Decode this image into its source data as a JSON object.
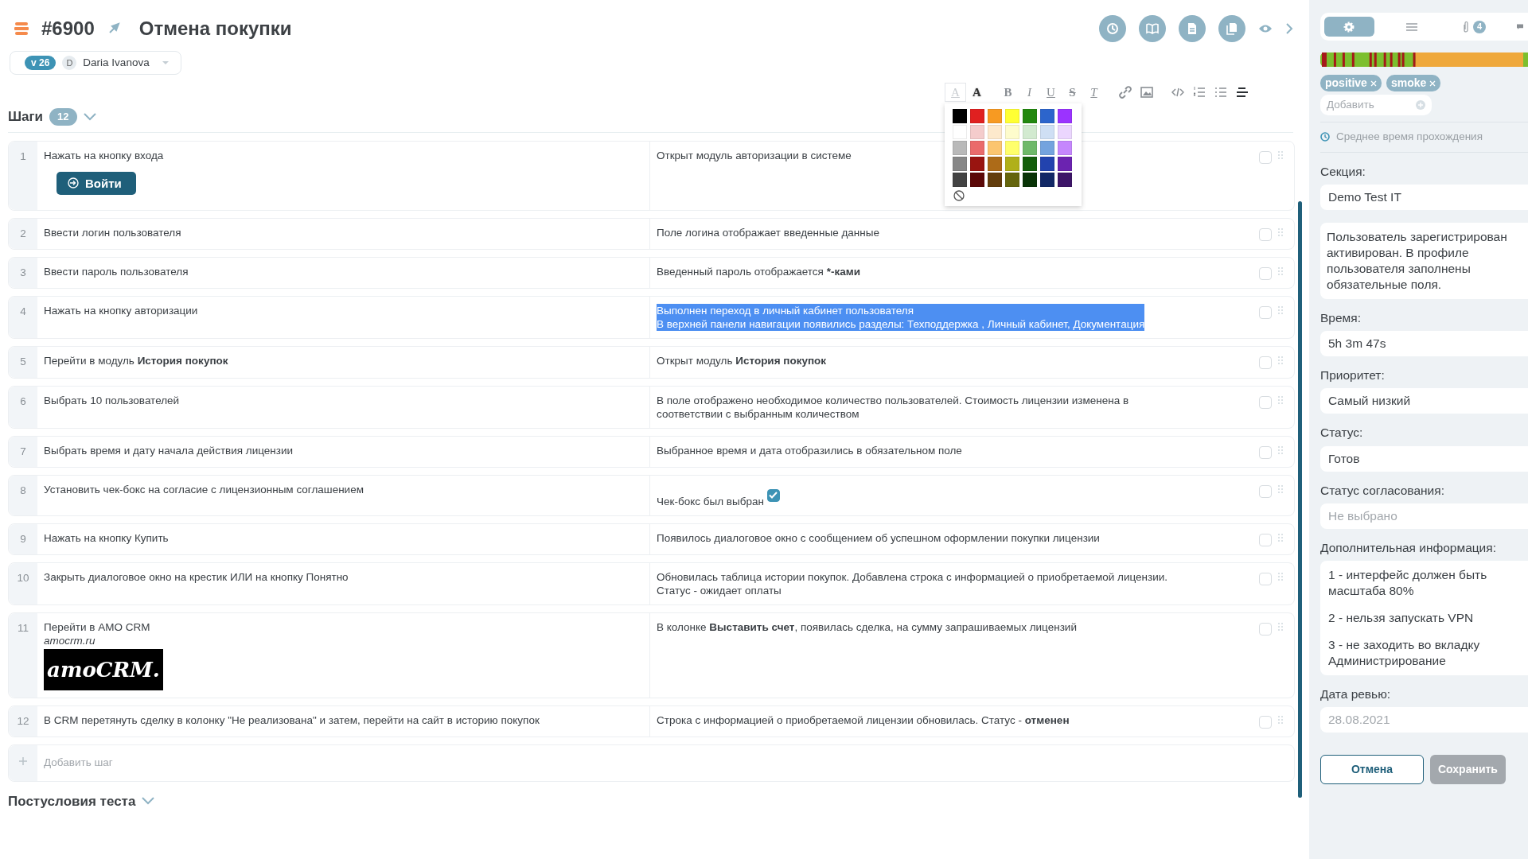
{
  "header": {
    "number": "#6900",
    "title": "Отмена покупки",
    "version": "v 26",
    "author_initial": "D",
    "author": "Daria Ivanova"
  },
  "editor_toolbar": [
    {
      "kind": "text-color",
      "glyph": "A",
      "selected": true
    },
    {
      "kind": "highlight",
      "glyph": "A",
      "selected": false
    },
    {
      "kind": "bold",
      "glyph": "B",
      "selected": false
    },
    {
      "kind": "italic",
      "glyph": "I",
      "selected": false
    },
    {
      "kind": "underline",
      "glyph": "U",
      "selected": false
    },
    {
      "kind": "strike",
      "glyph": "S",
      "selected": false
    },
    {
      "kind": "clear",
      "glyph": "T",
      "selected": false
    },
    {
      "kind": "link",
      "selected": false
    },
    {
      "kind": "image",
      "selected": false
    },
    {
      "kind": "code",
      "selected": false
    },
    {
      "kind": "ordered-list",
      "selected": false
    },
    {
      "kind": "bullet-list",
      "selected": false
    },
    {
      "kind": "align",
      "selected": false
    }
  ],
  "color_palette": [
    [
      {
        "color": "#000000"
      },
      {
        "color": "#e02020"
      },
      {
        "color": "#f79a22"
      },
      {
        "color": "#ffff33"
      },
      {
        "color": "#22880f"
      },
      {
        "color": "#2c65cc"
      },
      {
        "color": "#9b33ff"
      }
    ],
    [
      {
        "color": "#ffffff"
      },
      {
        "color": "#f4cccc"
      },
      {
        "color": "#fde9cc"
      },
      {
        "color": "#fefccc"
      },
      {
        "color": "#d2ead0"
      },
      {
        "color": "#cfdff4"
      },
      {
        "color": "#ebd6fe"
      }
    ],
    [
      {
        "color": "#b9b9b9"
      },
      {
        "color": "#ea6b6b"
      },
      {
        "color": "#fbc56f"
      },
      {
        "color": "#ffff6b"
      },
      {
        "color": "#6fb96a"
      },
      {
        "color": "#74a3de"
      },
      {
        "color": "#c587fd"
      }
    ],
    [
      {
        "color": "#878787"
      },
      {
        "color": "#991410"
      },
      {
        "color": "#ad6b18"
      },
      {
        "color": "#b0b01a"
      },
      {
        "color": "#135e0b"
      },
      {
        "color": "#2243ae"
      },
      {
        "color": "#6b23b0"
      }
    ],
    [
      {
        "color": "#434343"
      },
      {
        "color": "#5b0807"
      },
      {
        "color": "#633d0c"
      },
      {
        "color": "#65650d"
      },
      {
        "color": "#093407"
      },
      {
        "color": "#122866"
      },
      {
        "color": "#3d1568"
      }
    ]
  ],
  "steps_section": {
    "title": "Шаги",
    "count": "12"
  },
  "steps": [
    {
      "number": "1",
      "action": "Нажать на кнопку входа",
      "action_button": "Войти",
      "expected": "Открыт модуль авторизации в системе",
      "highlighted": false,
      "checked": false
    },
    {
      "number": "2",
      "action": "Ввести логин пользователя",
      "expected": "Поле логина отображает введенные данные",
      "highlighted": false,
      "checked": false
    },
    {
      "number": "3",
      "action": "Ввести пароль пользователя",
      "expected": [
        {
          "text": "Введенный пароль отображается "
        },
        {
          "text": "*-ками",
          "bold": true
        }
      ],
      "highlighted": false,
      "checked": false
    },
    {
      "number": "4",
      "action": "Нажать на кнопку авторизации",
      "expected": "Выполнен переход в личный кабинет пользователя\nВ верхней панели навигации появились разделы: Техподдержка , Личный кабинет, Документация",
      "highlighted": true,
      "checked": false
    },
    {
      "number": "5",
      "action": [
        {
          "text": "Перейти в модуль "
        },
        {
          "text": "История покупок",
          "bold": true
        }
      ],
      "expected": [
        {
          "text": "Открыт модуль "
        },
        {
          "text": "История покупок",
          "bold": true
        }
      ],
      "highlighted": false,
      "checked": false
    },
    {
      "number": "6",
      "action": "Выбрать 10 пользователей",
      "expected": "В поле отображено необходимое количество пользователей. Стоимость лицензии изменена в\nсоответствии с выбранным количеством",
      "highlighted": false,
      "checked": false
    },
    {
      "number": "7",
      "action": "Выбрать время и дату начала действия лицензии",
      "expected": "Выбранное время и дата отобразились в обязательном поле",
      "highlighted": false,
      "checked": false
    },
    {
      "number": "8",
      "action": "Установить чек-бокс на согласие с лицензионным соглашением",
      "expected": "Чек-бокс был выбран",
      "expected_checkbox": true,
      "highlighted": false,
      "checked": false
    },
    {
      "number": "9",
      "action": "Нажать на кнопку Купить",
      "expected": "Появилось диалоговое окно с сообщением об успешном оформлении покупки лицензии",
      "highlighted": false,
      "checked": false
    },
    {
      "number": "10",
      "action": "Закрыть диалоговое окно на крестик ИЛИ на кнопку Понятно",
      "expected": "Обновилась таблица истории покупок. Добавлена строка с информацией о приобретаемой лицензии.\nСтатус - ожидает оплаты",
      "highlighted": false,
      "checked": false
    },
    {
      "number": "11",
      "action": "Перейти в AMO CRM",
      "action_note": "amocrm.ru",
      "action_image": "amoCRM.",
      "expected": [
        {
          "text": "В колонке "
        },
        {
          "text": "Выставить счет",
          "bold": true
        },
        {
          "text": ", появилась сделка, на сумму запрашиваемых лицензий"
        }
      ],
      "highlighted": false,
      "checked": false
    },
    {
      "number": "12",
      "action": "В CRM перетянуть сделку в колонку \"Не реализована\" и затем, перейти на сайт в историю покупок",
      "expected": [
        {
          "text": "Строка с информацией о приобретаемой лицензии обновилась. Статус - "
        },
        {
          "text": "отменен",
          "bold": true
        }
      ],
      "highlighted": false,
      "checked": false
    }
  ],
  "add_step": {
    "label": "Добавить шаг"
  },
  "postconditions": {
    "title": "Постусловия теста"
  },
  "sidebar": {
    "tabs": [
      {
        "kind": "settings",
        "selected": true
      },
      {
        "kind": "list",
        "selected": false
      },
      {
        "kind": "attachments",
        "count": "4",
        "selected": false
      },
      {
        "kind": "comments",
        "selected": false
      }
    ],
    "tags": [
      {
        "label": "positive"
      },
      {
        "label": "smoke"
      }
    ],
    "add_tag": {
      "placeholder": "Добавить"
    },
    "avg_time_link": "Среднее время прохождения",
    "fields": [
      {
        "label": "Секция:",
        "value": "Demo Test IT"
      },
      {
        "value": "Пользователь зарегистрирован активирован. В профиле пользователя заполнены обязательные поля."
      },
      {
        "label": "Время:",
        "value": "5h 3m 47s"
      },
      {
        "label": "Приоритет:",
        "value": "Самый низкий"
      },
      {
        "label": "Статус:",
        "value": "Готов"
      },
      {
        "label": "Статус согласования:",
        "placeholder": "Не выбрано"
      },
      {
        "label": "Дополнительная информация:",
        "lines": [
          "1 - интерфейс должен быть масштаба 80%",
          "2 - нельзя запускать VPN",
          "3 - не заходить во вкладку Администрирование"
        ]
      },
      {
        "label": "Дата ревью:",
        "placeholder": "28.08.2021"
      }
    ],
    "buttons": [
      {
        "label": "Отмена",
        "kind": "outline",
        "disabled": false
      },
      {
        "label": "Сохранить",
        "kind": "primary",
        "disabled": true
      }
    ]
  }
}
